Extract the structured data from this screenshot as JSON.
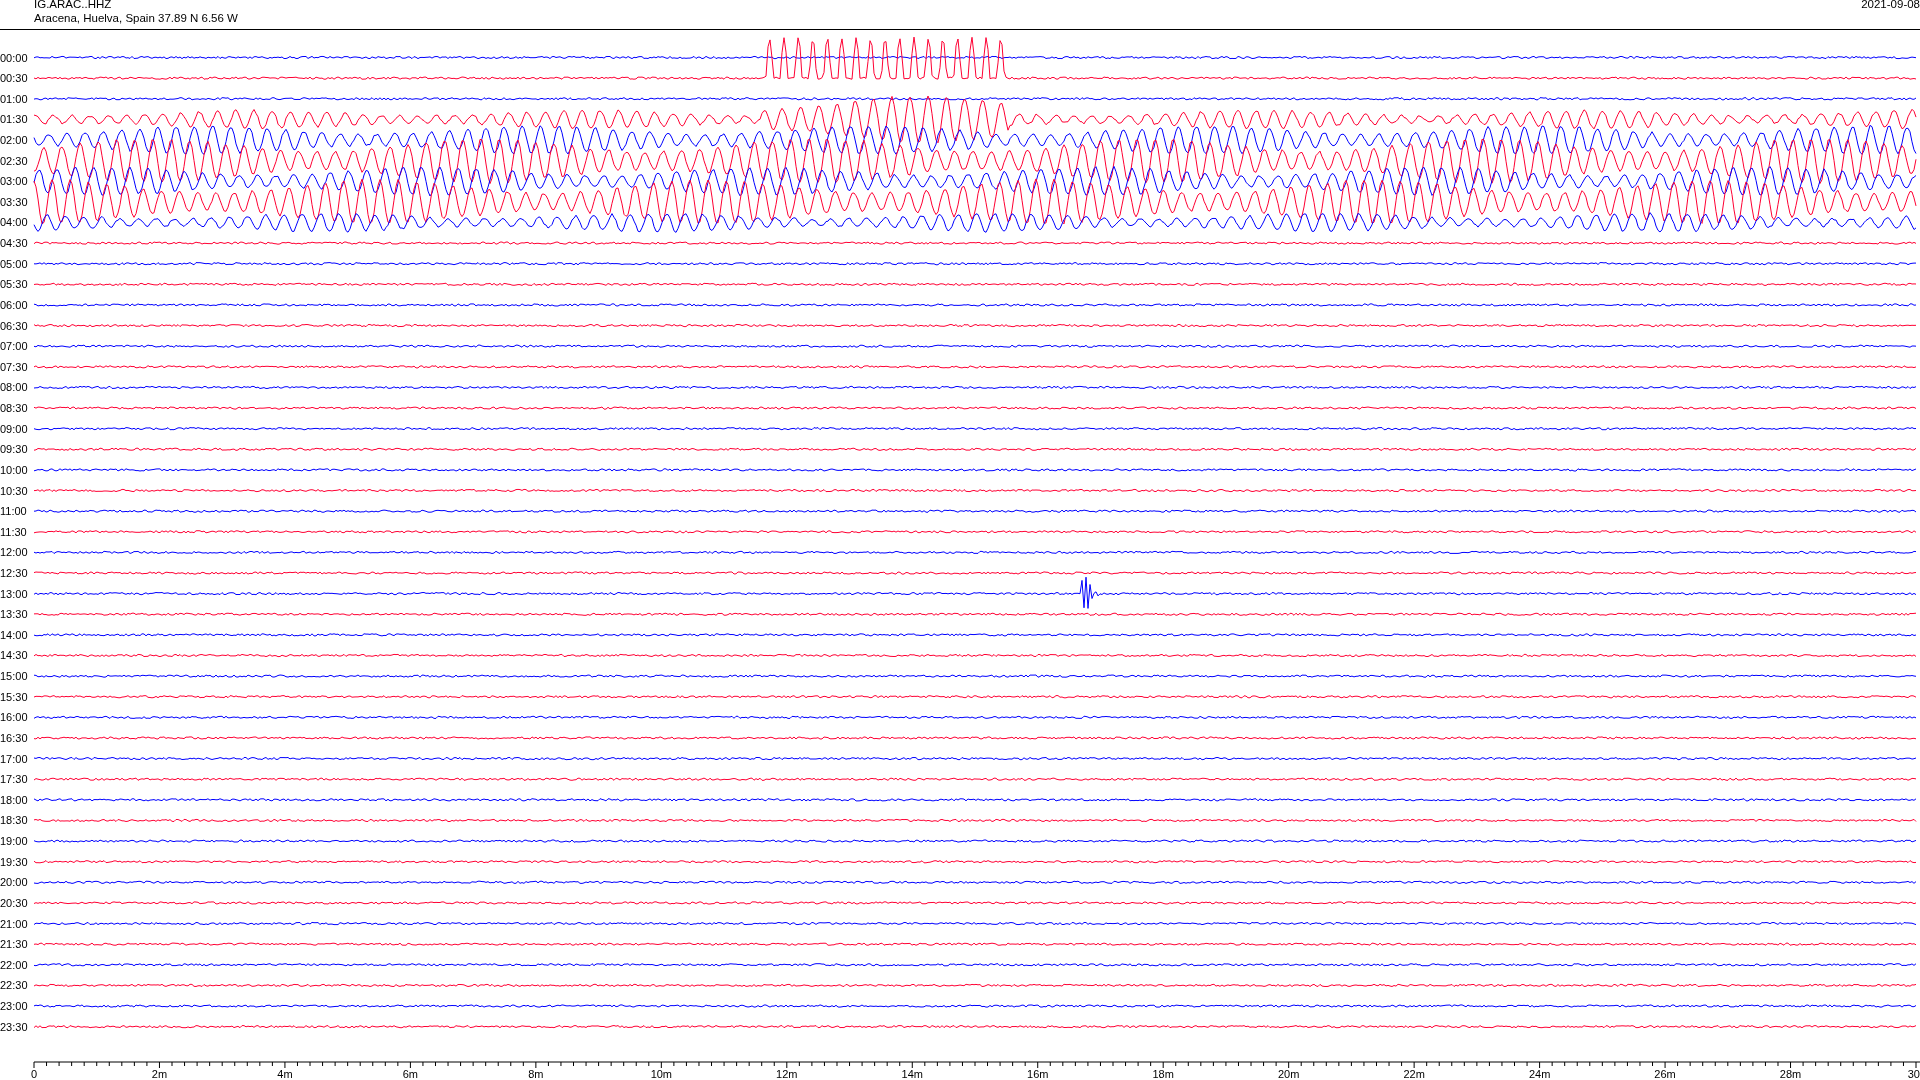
{
  "header": {
    "station": "IG.ARAC..HHZ",
    "location": "Aracena, Huelva, Spain  37.89 N 6.56 W",
    "date": "2021-09-08"
  },
  "rows": [
    {
      "time": "00:00",
      "color": "#0000ff"
    },
    {
      "time": "00:30",
      "color": "#ff0033"
    },
    {
      "time": "01:00",
      "color": "#0000ff"
    },
    {
      "time": "01:30",
      "color": "#ff0033"
    },
    {
      "time": "02:00",
      "color": "#0000ff"
    },
    {
      "time": "02:30",
      "color": "#ff0033"
    },
    {
      "time": "03:00",
      "color": "#0000ff"
    },
    {
      "time": "03:30",
      "color": "#ff0033"
    },
    {
      "time": "04:00",
      "color": "#0000ff"
    },
    {
      "time": "04:30",
      "color": "#ff0033"
    },
    {
      "time": "05:00",
      "color": "#0000ff"
    },
    {
      "time": "05:30",
      "color": "#ff0033"
    },
    {
      "time": "06:00",
      "color": "#0000ff"
    },
    {
      "time": "06:30",
      "color": "#ff0033"
    },
    {
      "time": "07:00",
      "color": "#0000ff"
    },
    {
      "time": "07:30",
      "color": "#ff0033"
    },
    {
      "time": "08:00",
      "color": "#0000ff"
    },
    {
      "time": "08:30",
      "color": "#ff0033"
    },
    {
      "time": "09:00",
      "color": "#0000ff"
    },
    {
      "time": "09:30",
      "color": "#ff0033"
    },
    {
      "time": "10:00",
      "color": "#0000ff"
    },
    {
      "time": "10:30",
      "color": "#ff0033"
    },
    {
      "time": "11:00",
      "color": "#0000ff"
    },
    {
      "time": "11:30",
      "color": "#ff0033"
    },
    {
      "time": "12:00",
      "color": "#0000ff"
    },
    {
      "time": "12:30",
      "color": "#ff0033"
    },
    {
      "time": "13:00",
      "color": "#0000ff"
    },
    {
      "time": "13:30",
      "color": "#ff0033"
    },
    {
      "time": "14:00",
      "color": "#0000ff"
    },
    {
      "time": "14:30",
      "color": "#ff0033"
    },
    {
      "time": "15:00",
      "color": "#0000ff"
    },
    {
      "time": "15:30",
      "color": "#ff0033"
    },
    {
      "time": "16:00",
      "color": "#0000ff"
    },
    {
      "time": "16:30",
      "color": "#ff0033"
    },
    {
      "time": "17:00",
      "color": "#0000ff"
    },
    {
      "time": "17:30",
      "color": "#ff0033"
    },
    {
      "time": "18:00",
      "color": "#0000ff"
    },
    {
      "time": "18:30",
      "color": "#ff0033"
    },
    {
      "time": "19:00",
      "color": "#0000ff"
    },
    {
      "time": "19:30",
      "color": "#ff0033"
    },
    {
      "time": "20:00",
      "color": "#0000ff"
    },
    {
      "time": "20:30",
      "color": "#ff0033"
    },
    {
      "time": "21:00",
      "color": "#0000ff"
    },
    {
      "time": "21:30",
      "color": "#ff0033"
    },
    {
      "time": "22:00",
      "color": "#0000ff"
    },
    {
      "time": "22:30",
      "color": "#ff0033"
    },
    {
      "time": "23:00",
      "color": "#0000ff"
    },
    {
      "time": "23:30",
      "color": "#ff0033"
    }
  ],
  "x_axis": {
    "ticks": [
      "0",
      "2m",
      "4m",
      "6m",
      "8m",
      "10m",
      "12m",
      "14m",
      "16m",
      "18m",
      "20m",
      "22m",
      "24m",
      "26m",
      "28m",
      "30"
    ]
  }
}
